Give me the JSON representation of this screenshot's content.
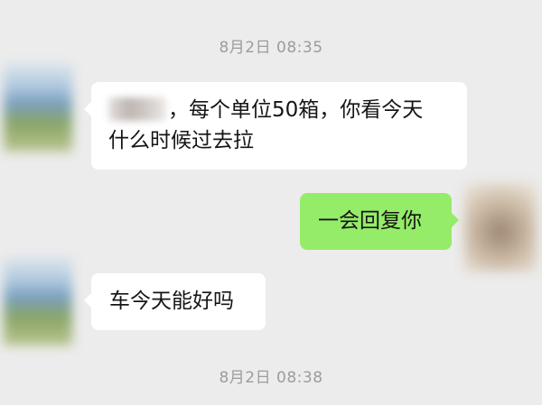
{
  "timestamps": {
    "first": "8月2日 08:35",
    "second": "8月2日 08:38"
  },
  "messages": [
    {
      "sender": "other",
      "text_line1": "，每个单位50箱，你看今天",
      "text_line2": "什么时候过去拉"
    },
    {
      "sender": "self",
      "text": "一会回复你"
    },
    {
      "sender": "other",
      "text": "车今天能好吗"
    }
  ],
  "colors": {
    "background": "#ececec",
    "incoming_bubble": "#ffffff",
    "outgoing_bubble": "#95ec69",
    "timestamp_text": "#9c9c9c"
  }
}
